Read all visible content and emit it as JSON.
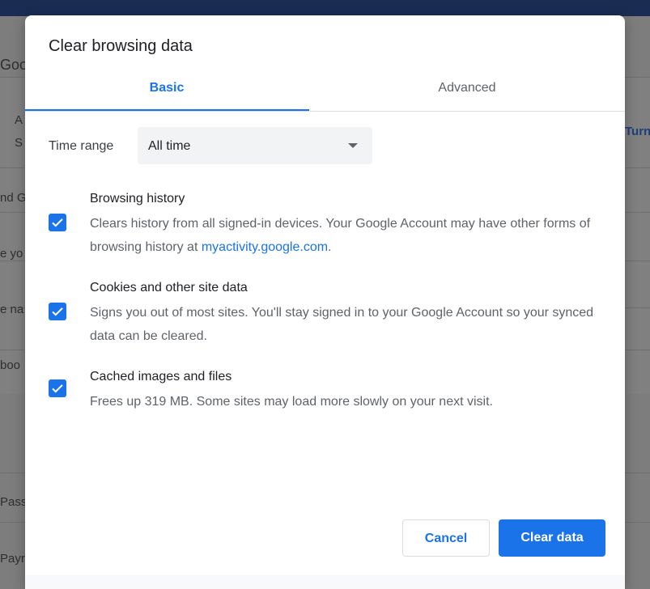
{
  "background": {
    "fragments": [
      "Goog",
      "A",
      "S",
      "Turn",
      "nd G",
      "e yo",
      "e na",
      "boo",
      "Pass",
      "Payr"
    ]
  },
  "dialog": {
    "title": "Clear browsing data",
    "tabs": [
      {
        "label": "Basic",
        "active": true
      },
      {
        "label": "Advanced",
        "active": false
      }
    ],
    "time_range": {
      "label": "Time range",
      "value": "All time"
    },
    "options": [
      {
        "title": "Browsing history",
        "checked": true,
        "desc": "Clears history from all signed-in devices. Your Google Account may have other forms of browsing history at ",
        "link": "myactivity.google.com",
        "desc_after": "."
      },
      {
        "title": "Cookies and other site data",
        "checked": true,
        "desc": "Signs you out of most sites. You'll stay signed in to your Google Account so your synced data can be cleared."
      },
      {
        "title": "Cached images and files",
        "checked": true,
        "desc": "Frees up 319 MB. Some sites may load more slowly on your next visit."
      }
    ],
    "buttons": {
      "cancel": "Cancel",
      "clear": "Clear data"
    }
  },
  "colors": {
    "accent": "#1a73e8",
    "topbar": "#1a2c52"
  }
}
